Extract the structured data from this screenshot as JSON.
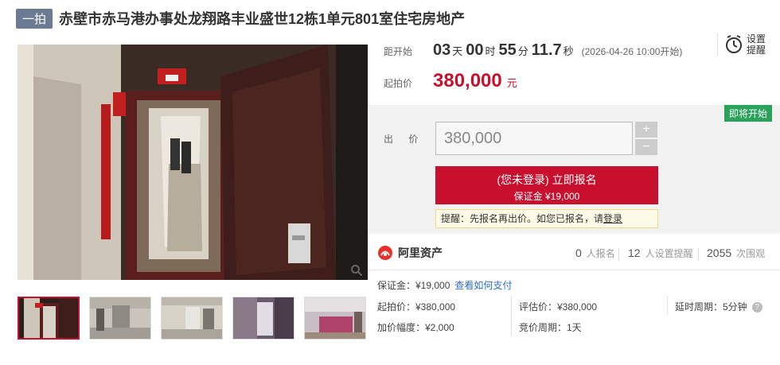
{
  "header": {
    "tag": "一拍",
    "title": "赤壁市赤马港办事处龙翔路丰业盛世12栋1单元801室住宅房地产"
  },
  "countdown": {
    "label": "距开始",
    "days": "03",
    "days_unit": "天",
    "hours": "00",
    "hours_unit": "时",
    "minutes": "55",
    "minutes_unit": "分",
    "seconds": "11.7",
    "seconds_unit": "秒",
    "start_note": "(2026-04-26 10:00开始)"
  },
  "reminder": {
    "label_line1": "设置",
    "label_line2": "提醒",
    "icon": "alarm-clock-icon"
  },
  "starting_price": {
    "label": "起拍价",
    "value": "380,000",
    "unit": "元"
  },
  "bid": {
    "status_badge": "即将开始",
    "label": "出 价",
    "input_value": "380,000",
    "plus": "+",
    "minus": "−",
    "signup_main": "(您未登录) 立即报名",
    "signup_sub": "保证金 ¥19,000",
    "tip_prefix": "提醒：先报名再出价。如您已报名，请",
    "tip_link": "登录"
  },
  "stats": {
    "platform": "阿里资产",
    "signups_num": "0",
    "signups_label": "人报名",
    "reminders_num": "12",
    "reminders_label": "人设置提醒",
    "views_num": "2055",
    "views_label": "次围观"
  },
  "details": {
    "deposit": "保证金：¥19,000",
    "deposit_link": "查看如何支付",
    "start_price": "起拍价：¥380,000",
    "appraisal": "评估价：¥380,000",
    "delay": "延时周期：5分钟",
    "increment": "加价幅度：¥2,000",
    "cycle": "竞价周期：1天"
  },
  "colors": {
    "accent_red": "#c8102e",
    "badge_green": "#2aa35a",
    "tag_gray_blue": "#6c7a94",
    "link_blue": "#2d6dcc"
  },
  "thumbnails_count": 5
}
